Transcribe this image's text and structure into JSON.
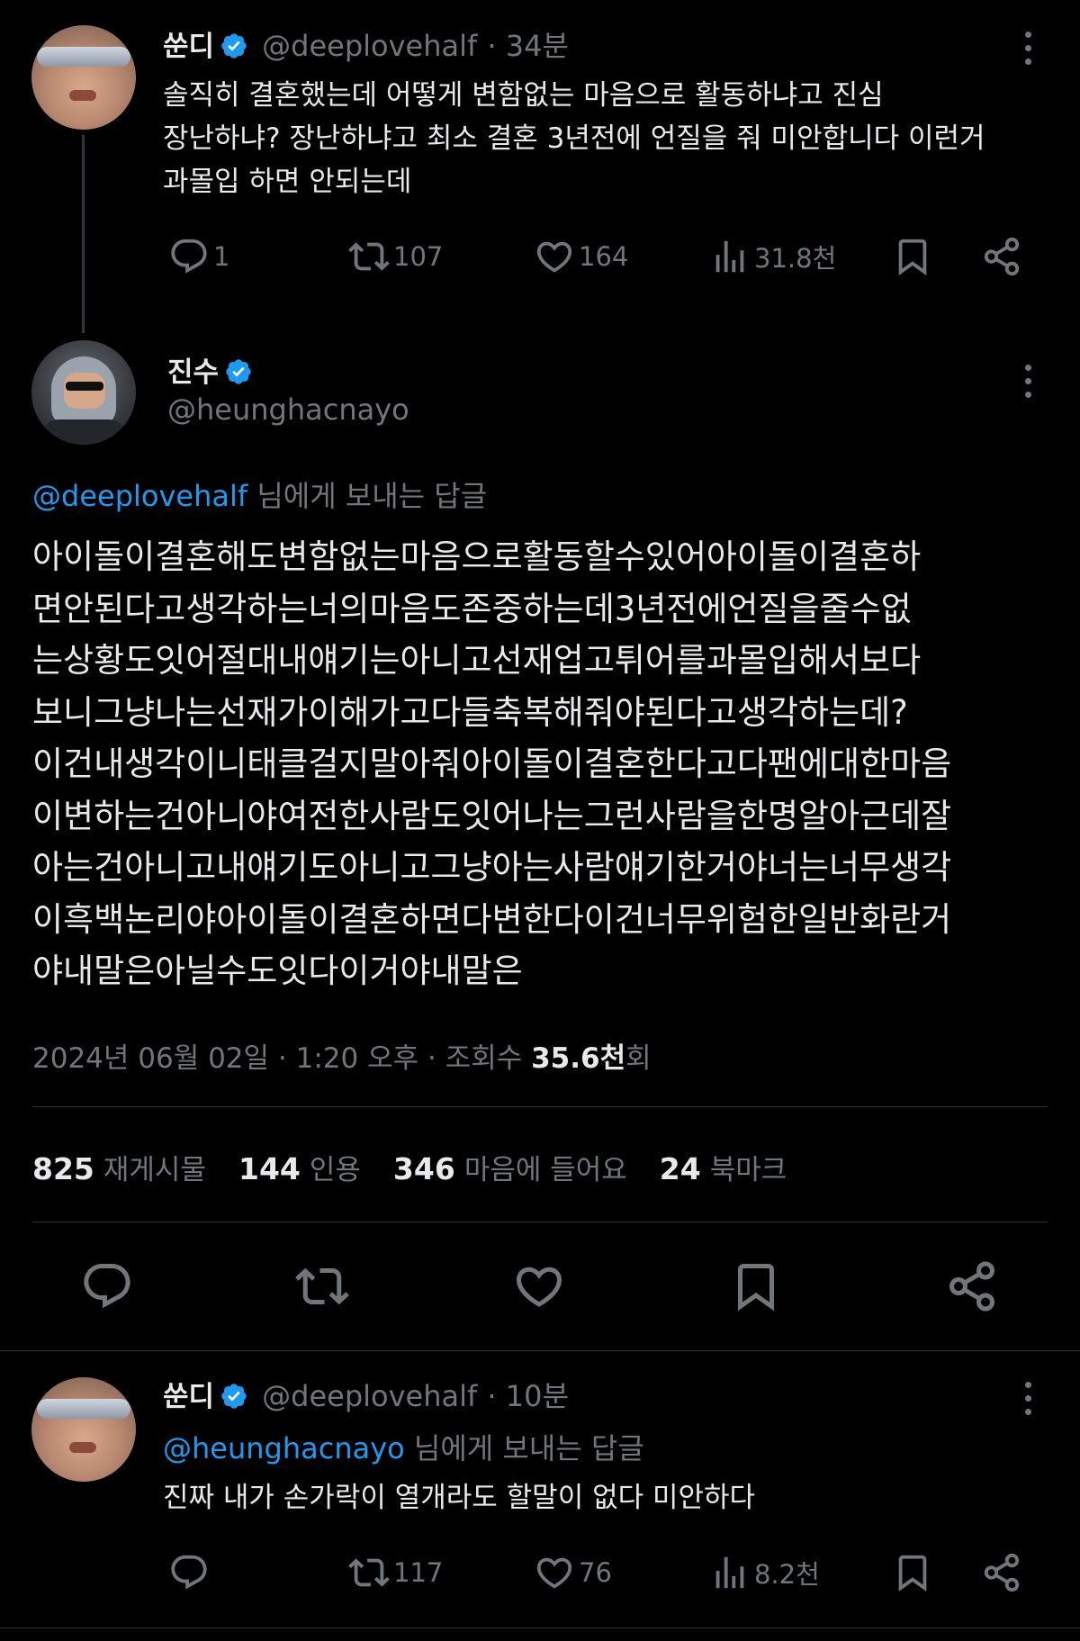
{
  "tweet1": {
    "name": "쑨디",
    "handle": "@deeplovehalf",
    "time": "· 34분",
    "lines": [
      "솔직히 결혼했는데 어떻게 변함없는 마음으로 활동하냐고 진심",
      "장난하냐? 장난하냐고 최소 결혼 3년전에 언질을 줘 미안합니다 이런거",
      "과몰입 하면 안되는데"
    ],
    "replies": "1",
    "retweets": "107",
    "likes": "164",
    "views": "31.8천"
  },
  "main": {
    "name": "진수",
    "handle": "@heunghacnayo",
    "reply_to_handle": "@deeplovehalf",
    "reply_to_suffix": " 님에게 보내는 답글",
    "lines": [
      "아이돌이결혼해도변함없는마음으로활동할수있어아이돌이결혼하",
      "면안된다고생각하는너의마음도존중하는데3년전에언질을줄수없",
      "는상황도잇어절대내얘기는아니고선재업고튀어를과몰입해서보다",
      "보니그냥나는선재가이해가고다들축복해줘야된다고생각하는데?",
      "이건내생각이니태클걸지말아줘아이돌이결혼한다고다팬에대한마음",
      "이변하는건아니야여전한사람도잇어나는그런사람을한명알아근데잘",
      "아는건아니고내얘기도아니고그냥아는사람얘기한거야너는너무생각",
      "이흑백논리야아이돌이결혼하면다변한다이건너무위험한일반화란거",
      "야내말은아닐수도잇다이거야내말은"
    ],
    "timestamp": "2024년 06월 02일 · 1:20 오후 · 조회수 ",
    "views_count": "35.6천",
    "views_suffix": "회",
    "stats": {
      "reposts": "825",
      "reposts_label": "재게시물",
      "quotes": "144",
      "quotes_label": "인용",
      "likes": "346",
      "likes_label": "마음에 들어요",
      "bookmarks": "24",
      "bookmarks_label": "북마크"
    }
  },
  "tweet3": {
    "name": "쑨디",
    "handle": "@deeplovehalf",
    "time": "· 10분",
    "reply_to_handle": "@heunghacnayo",
    "reply_to_suffix": " 님에게 보내는 답글",
    "text": "진짜 내가 손가락이 열개라도 할말이 없다 미안하다",
    "replies": "",
    "retweets": "117",
    "likes": "76",
    "views": "8.2천"
  },
  "colors": {
    "background": "#000000",
    "text": "#e7e9ea",
    "muted": "#71767b",
    "accent": "#1d9bf0",
    "divider": "#2f3336"
  }
}
